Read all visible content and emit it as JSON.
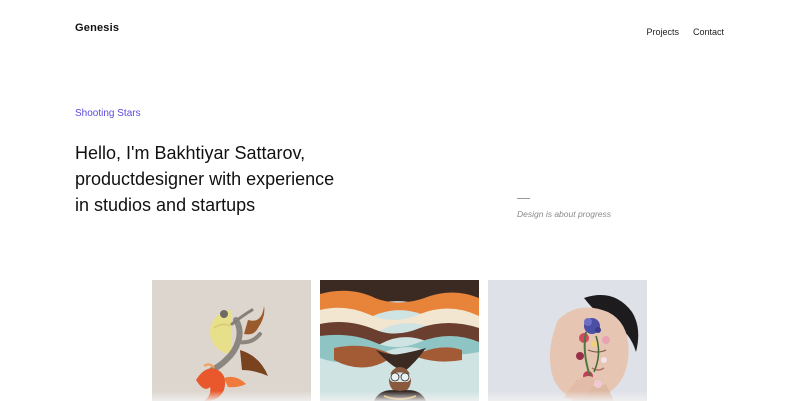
{
  "header": {
    "brand": "Genesis",
    "nav": [
      {
        "label": "Projects"
      },
      {
        "label": "Contact"
      }
    ]
  },
  "hero": {
    "eyebrow": "Shooting Stars",
    "headline_lines": [
      "Hello, I'm Bakhtiyar Sattarov,",
      "productdesigner with experience",
      "in studios and startups"
    ],
    "tagline": "Design is about progress"
  },
  "colors": {
    "accent": "#5b4bde",
    "text": "#111111",
    "muted": "#8a8a8a"
  },
  "gallery": {
    "items": [
      {
        "icon": "dancer-collage-artwork"
      },
      {
        "icon": "swirling-hair-portrait-artwork"
      },
      {
        "icon": "flower-face-portrait-artwork"
      }
    ]
  }
}
